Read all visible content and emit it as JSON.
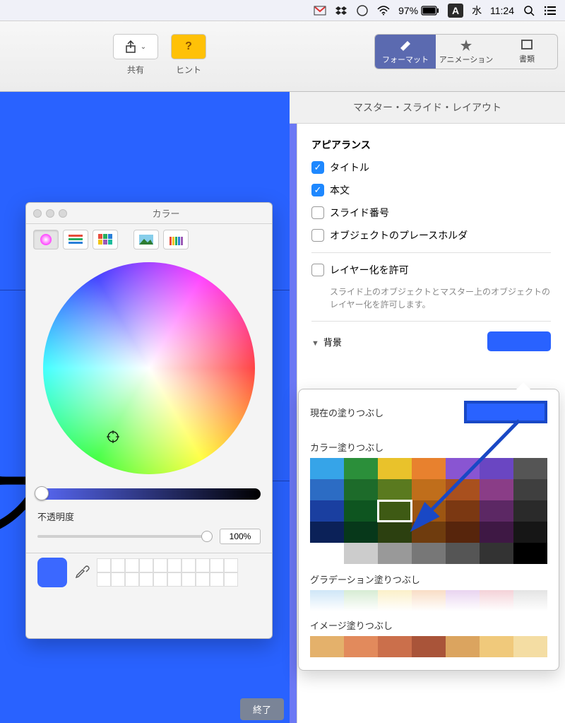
{
  "menubar": {
    "battery": "97%",
    "input": "A",
    "day": "水",
    "time": "11:24"
  },
  "toolbar": {
    "share": "共有",
    "hint": "ヒント",
    "format": "フォーマット",
    "animation": "アニメーション",
    "document": "書類"
  },
  "masterbar": {
    "title": "マスター・スライド・レイアウト"
  },
  "canvas": {
    "text": "ス"
  },
  "sidebar": {
    "appearance": "アピアランス",
    "title_cb": "タイトル",
    "body_cb": "本文",
    "slide_num": "スライド番号",
    "placeholder": "オブジェクトのプレースホルダ",
    "allow_layer": "レイヤー化を許可",
    "layer_help": "スライド上のオブジェクトとマスター上のオブジェクトのレイヤー化を許可します。",
    "background": "背景"
  },
  "popover": {
    "current_fill": "現在の塗りつぶし",
    "color_fill": "カラー塗りつぶし",
    "grad_fill": "グラデーション塗りつぶし",
    "image_fill": "イメージ塗りつぶし",
    "palette": [
      [
        "#36a4e8",
        "#2b8f3a",
        "#e9c22b",
        "#e8812e",
        "#8955d2",
        "#6a46c2",
        "#555555"
      ],
      [
        "#2c6cc4",
        "#1d6b2a",
        "#5a7a1f",
        "#c06e1b",
        "#a9501e",
        "#8a3d87",
        "#3f3f3f"
      ],
      [
        "#1a3fa0",
        "#0e5520",
        "#3e5a14",
        "#9d5612",
        "#7b3812",
        "#5c2864",
        "#2a2a2a"
      ],
      [
        "#0b2158",
        "#07381a",
        "#2c4010",
        "#6f3c0e",
        "#57250c",
        "#3e1844",
        "#161616"
      ],
      [
        "#ffffff",
        "#cccccc",
        "#999999",
        "#777777",
        "#555555",
        "#333333",
        "#000000"
      ]
    ],
    "grad_row": [
      "#cfe6f7",
      "#d7ecd4",
      "#fbf0c9",
      "#f9ddc5",
      "#e9d4f0",
      "#f4d2d8",
      "#e4e4e4"
    ],
    "image_row": [
      "#e4b16b",
      "#e28a5c",
      "#cb6f4b",
      "#a95439",
      "#dba45f",
      "#f0c97b",
      "#f4dda3"
    ]
  },
  "colorwin": {
    "title": "カラー",
    "opacity_label": "不透明度",
    "opacity_value": "100%"
  },
  "end_button": "終了"
}
